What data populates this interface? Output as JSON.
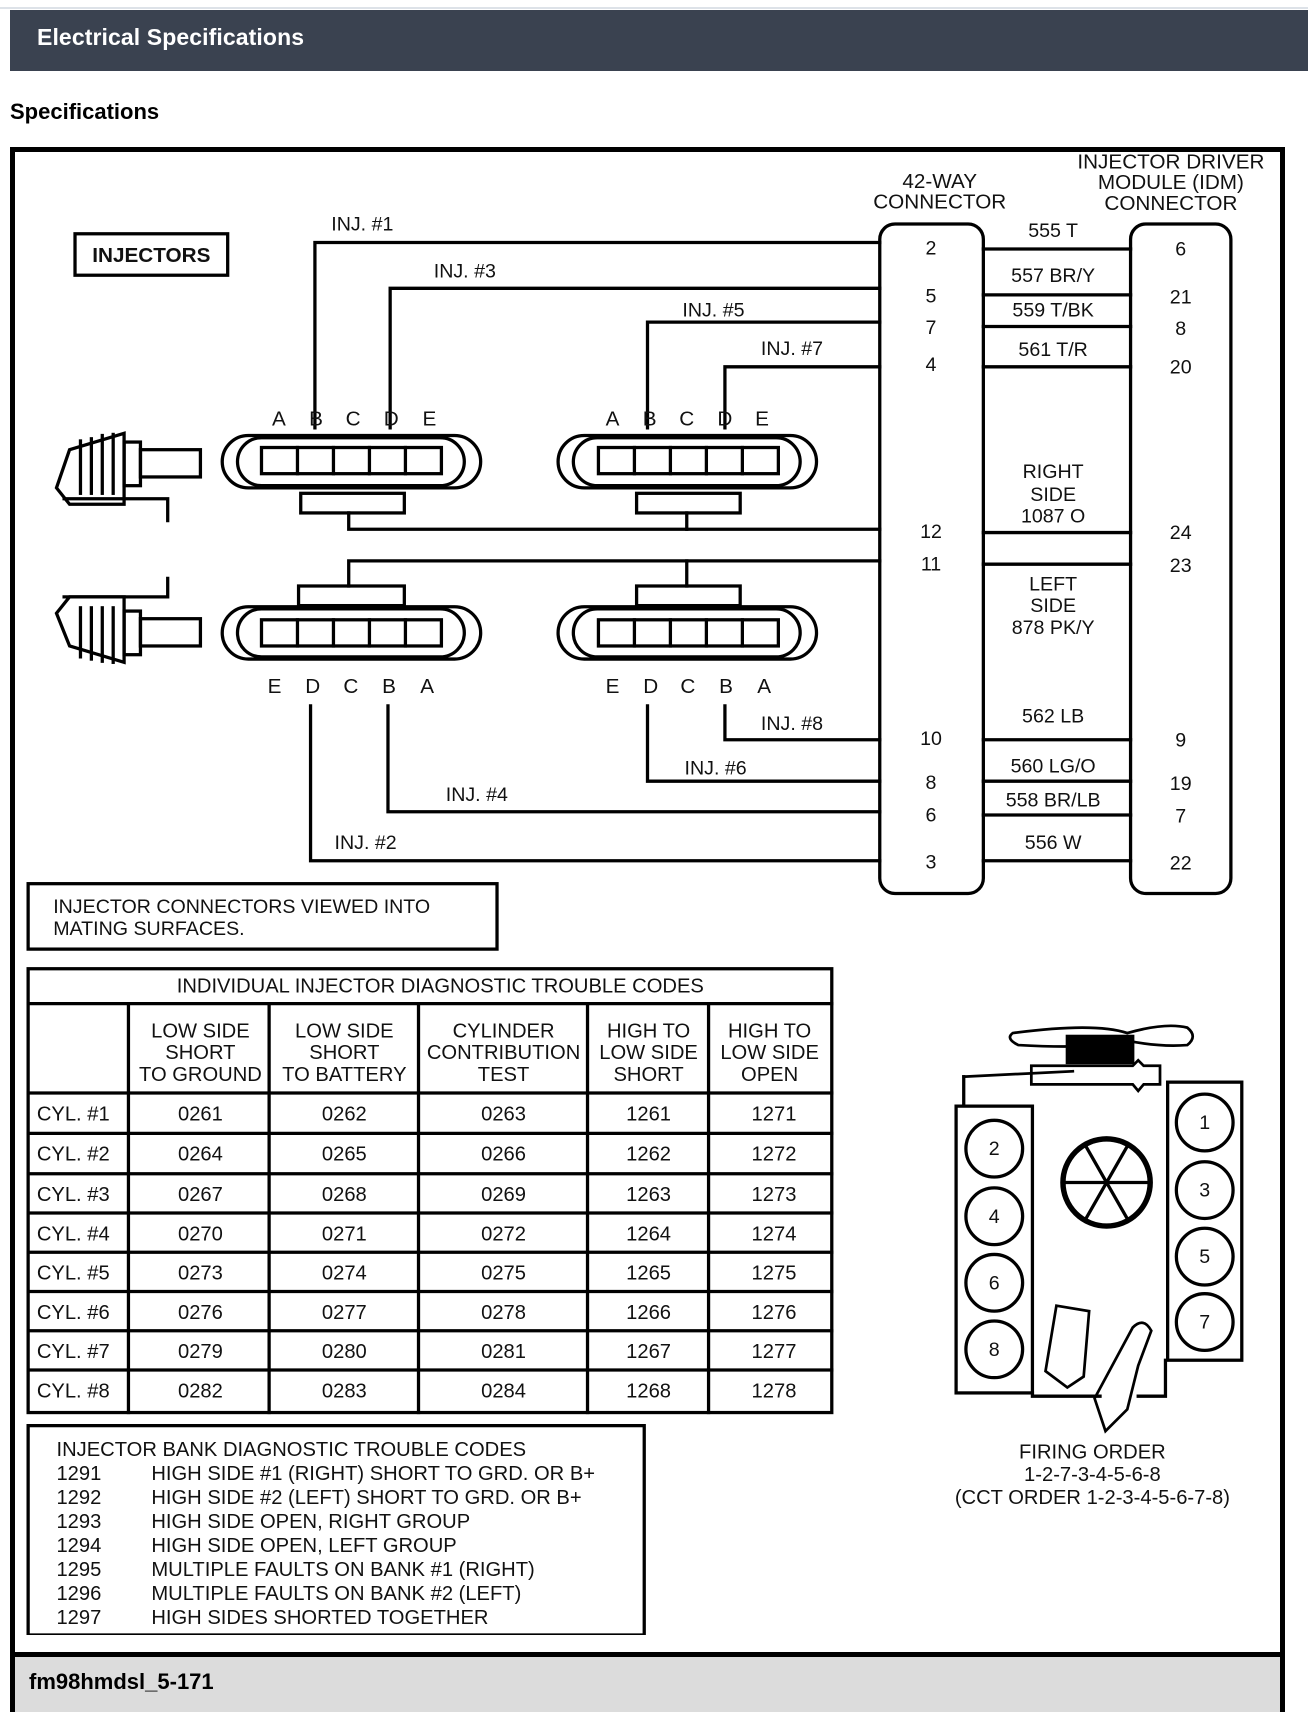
{
  "header": {
    "title": "Electrical Specifications"
  },
  "section": {
    "title": "Specifications"
  },
  "diagram": {
    "injectors_box": "INJECTORS",
    "connector_42": [
      "42-WAY",
      "CONNECTOR"
    ],
    "idm_connector": [
      "INJECTOR DRIVER",
      "MODULE (IDM)",
      "CONNECTOR"
    ],
    "pin_letters_top": [
      "A",
      "B",
      "C",
      "D",
      "E"
    ],
    "pin_letters_bottom": [
      "E",
      "D",
      "C",
      "B",
      "A"
    ],
    "injector_labels": {
      "inj1": "INJ. #1",
      "inj3": "INJ. #3",
      "inj5": "INJ. #5",
      "inj7": "INJ. #7",
      "inj8": "INJ. #8",
      "inj6": "INJ. #6",
      "inj4": "INJ. #4",
      "inj2": "INJ. #2"
    },
    "wires": [
      {
        "circuit": "555 T",
        "pin_42": "2",
        "pin_idm": "6"
      },
      {
        "circuit": "557 BR/Y",
        "pin_42": "5",
        "pin_idm": "21"
      },
      {
        "circuit": "559 T/BK",
        "pin_42": "7",
        "pin_idm": "8"
      },
      {
        "circuit": "561 T/R",
        "pin_42": "4",
        "pin_idm": "20"
      },
      {
        "circuit": "562 LB",
        "pin_42": "10",
        "pin_idm": "9"
      },
      {
        "circuit": "560 LG/O",
        "pin_42": "8",
        "pin_idm": "19"
      },
      {
        "circuit": "558 BR/LB",
        "pin_42": "6",
        "pin_idm": "7"
      },
      {
        "circuit": "556 W",
        "pin_42": "3",
        "pin_idm": "22"
      }
    ],
    "right_side": {
      "lines": [
        "RIGHT",
        "SIDE",
        "1087 O"
      ],
      "pin_42": "12",
      "pin_idm": "24"
    },
    "left_side": {
      "lines": [
        "LEFT",
        "SIDE",
        "878 PK/Y"
      ],
      "pin_42": "11",
      "pin_idm": "23"
    },
    "note": [
      "INJECTOR CONNECTORS VIEWED INTO",
      "MATING SURFACES."
    ]
  },
  "dtc_table": {
    "title": "INDIVIDUAL INJECTOR DIAGNOSTIC TROUBLE CODES",
    "columns": [
      [
        "LOW SIDE",
        "SHORT",
        "TO GROUND"
      ],
      [
        "LOW SIDE",
        "SHORT",
        "TO BATTERY"
      ],
      [
        "CYLINDER",
        "CONTRIBUTION",
        "TEST"
      ],
      [
        "HIGH TO",
        "LOW SIDE",
        "SHORT"
      ],
      [
        "HIGH TO",
        "LOW SIDE",
        "OPEN"
      ]
    ],
    "rows": [
      {
        "cyl": "CYL. #1",
        "codes": [
          "0261",
          "0262",
          "0263",
          "1261",
          "1271"
        ]
      },
      {
        "cyl": "CYL. #2",
        "codes": [
          "0264",
          "0265",
          "0266",
          "1262",
          "1272"
        ]
      },
      {
        "cyl": "CYL. #3",
        "codes": [
          "0267",
          "0268",
          "0269",
          "1263",
          "1273"
        ]
      },
      {
        "cyl": "CYL. #4",
        "codes": [
          "0270",
          "0271",
          "0272",
          "1264",
          "1274"
        ]
      },
      {
        "cyl": "CYL. #5",
        "codes": [
          "0273",
          "0274",
          "0275",
          "1265",
          "1275"
        ]
      },
      {
        "cyl": "CYL. #6",
        "codes": [
          "0276",
          "0277",
          "0278",
          "1266",
          "1276"
        ]
      },
      {
        "cyl": "CYL. #7",
        "codes": [
          "0279",
          "0280",
          "0281",
          "1267",
          "1277"
        ]
      },
      {
        "cyl": "CYL. #8",
        "codes": [
          "0282",
          "0283",
          "0284",
          "1268",
          "1278"
        ]
      }
    ]
  },
  "bank_dtc": {
    "title": "INJECTOR BANK DIAGNOSTIC TROUBLE CODES",
    "items": [
      {
        "code": "1291",
        "desc": "HIGH SIDE #1 (RIGHT) SHORT TO GRD. OR B+"
      },
      {
        "code": "1292",
        "desc": "HIGH SIDE #2 (LEFT) SHORT TO GRD. OR B+"
      },
      {
        "code": "1293",
        "desc": "HIGH SIDE OPEN, RIGHT GROUP"
      },
      {
        "code": "1294",
        "desc": "HIGH SIDE OPEN, LEFT GROUP"
      },
      {
        "code": "1295",
        "desc": "MULTIPLE FAULTS ON BANK #1 (RIGHT)"
      },
      {
        "code": "1296",
        "desc": "MULTIPLE FAULTS ON BANK #2 (LEFT)"
      },
      {
        "code": "1297",
        "desc": "HIGH SIDES SHORTED TOGETHER"
      }
    ]
  },
  "engine": {
    "left_bank": [
      "2",
      "4",
      "6",
      "8"
    ],
    "right_bank": [
      "1",
      "3",
      "5",
      "7"
    ],
    "firing_order": [
      "FIRING ORDER",
      "1-2-7-3-4-5-6-8",
      "(CCT ORDER 1-2-3-4-5-6-7-8)"
    ]
  },
  "caption": "fm98hmdsl_5-171"
}
